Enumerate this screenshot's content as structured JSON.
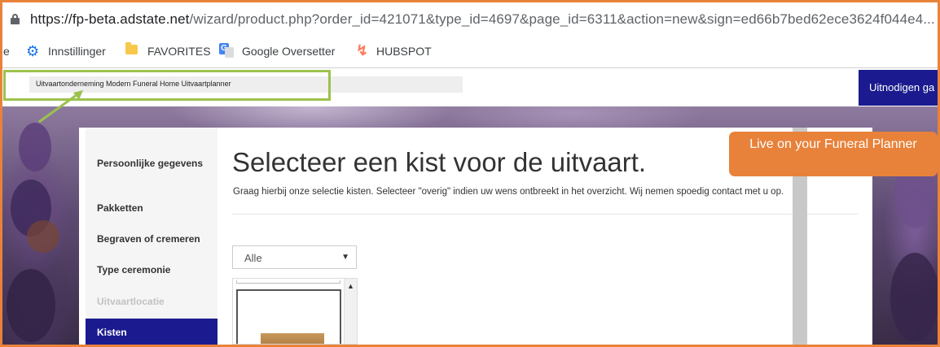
{
  "browser": {
    "url_host": "https://fp-beta.adstate.net",
    "url_rest": "/wizard/product.php?order_id=421071&type_id=4697&page_id=6311&action=new&sign=ed66b7bed62ece3624f044e4...",
    "bookmarks": [
      {
        "label": "e"
      },
      {
        "label": "Innstillinger",
        "icon": "gear-icon"
      },
      {
        "label": "FAVORITES",
        "icon": "folder-icon"
      },
      {
        "label": "Google Oversetter",
        "icon": "google-translate-icon"
      },
      {
        "label": "HUBSPOT",
        "icon": "hubspot-icon"
      }
    ]
  },
  "site": {
    "breadcrumb": "Uitvaartonderneming Modern Funeral Home Uitvaartplanner",
    "invite_button": "Uitnodigen ga",
    "accent_color": "#1b1b8f"
  },
  "sidebar": {
    "items": [
      {
        "label": "Persoonlijke gegevens",
        "state": "normal"
      },
      {
        "label": "Pakketten",
        "state": "normal"
      },
      {
        "label": "Begraven of cremeren",
        "state": "normal"
      },
      {
        "label": "Type ceremonie",
        "state": "normal"
      },
      {
        "label": "Uitvaartlocatie",
        "state": "disabled"
      },
      {
        "label": "Kisten",
        "state": "active"
      }
    ]
  },
  "main": {
    "title": "Selecteer een kist voor de uitvaart.",
    "subtitle": "Graag hierbij onze selectie kisten. Selecteer \"overig\" indien uw wens ontbreekt in het overzicht. Wij nemen spoedig contact met u op.",
    "filter_select": {
      "value": "Alle"
    }
  },
  "callout": {
    "text": "Live on your Funeral Planner",
    "color": "#e8823a"
  }
}
